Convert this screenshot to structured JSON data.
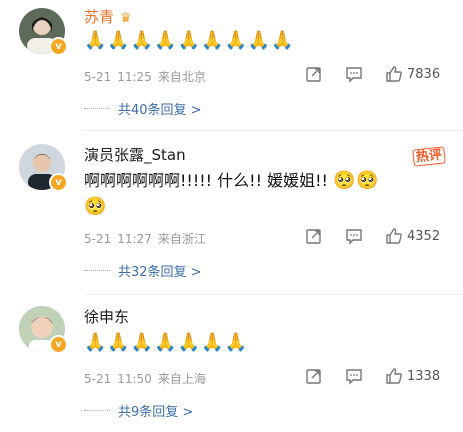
{
  "comments": [
    {
      "username": "苏青",
      "name_color": "orange",
      "has_crown": true,
      "hot_badge": "",
      "text": "",
      "emojis": "🙏🙏🙏🙏🙏🙏🙏🙏🙏",
      "emojis2": "",
      "date": "5-21",
      "time": "11:25",
      "location": "来自北京",
      "likes": "7836",
      "replies_label": "共40条回复 >"
    },
    {
      "username": "演员张露_Stan",
      "name_color": "dark",
      "has_crown": false,
      "hot_badge": "热评",
      "text": "啊啊啊啊啊啊!!!!!  什么!!  媛媛姐!!",
      "emojis": "🥺🥺",
      "emojis2": "🥺",
      "date": "5-21",
      "time": "11:27",
      "location": "来自浙江",
      "likes": "4352",
      "replies_label": "共32条回复 >"
    },
    {
      "username": "徐申东",
      "name_color": "dark",
      "has_crown": false,
      "hot_badge": "",
      "text": "",
      "emojis": "🙏🙏🙏🙏🙏🙏🙏",
      "emojis2": "",
      "date": "5-21",
      "time": "11:50",
      "location": "来自上海",
      "likes": "1338",
      "replies_label": "共9条回复 >"
    }
  ],
  "icons": {
    "share": "share-icon",
    "comment": "comment-icon",
    "like": "thumbs-up-icon",
    "verified": "verified-badge-icon"
  },
  "colors": {
    "accent_name": "#e8732a",
    "replies_link": "#3c6ea5",
    "meta": "#999999",
    "hot": "#f15a29"
  }
}
